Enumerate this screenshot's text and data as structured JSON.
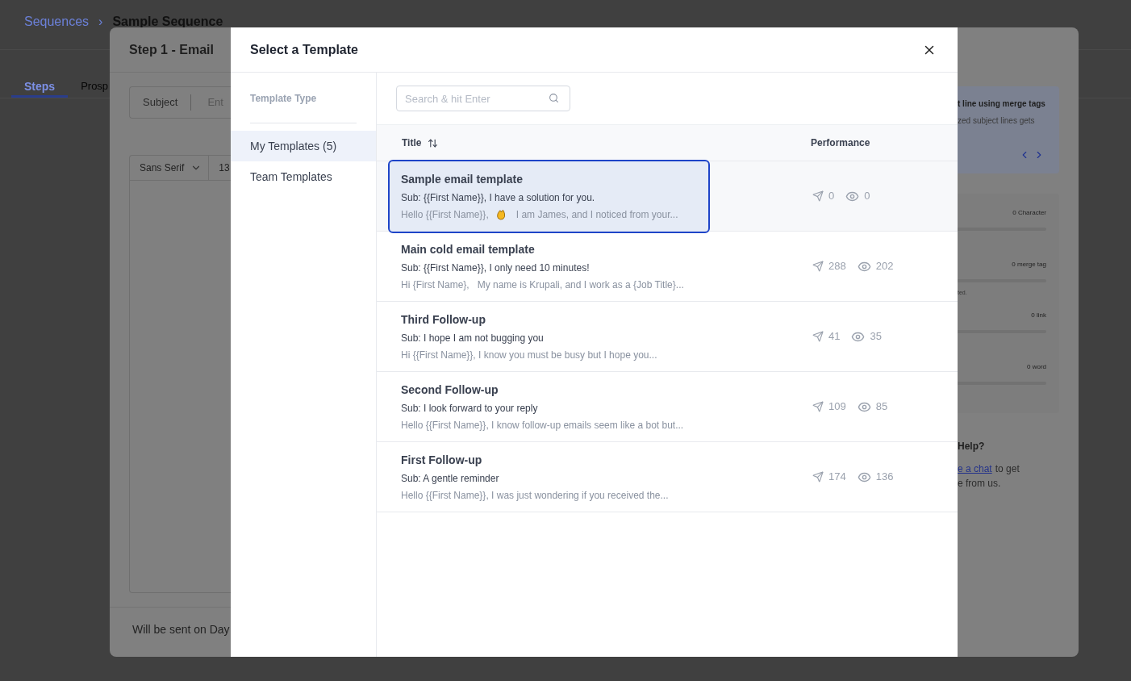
{
  "breadcrumb": {
    "parent": "Sequences",
    "separator": "›",
    "current": "Sample Sequence"
  },
  "page_tabs": [
    {
      "label": "Steps",
      "selected": true
    },
    {
      "label": "Prosp",
      "selected": false
    }
  ],
  "step_modal": {
    "title": "Step 1 - Email",
    "subject_label": "Subject",
    "subject_placeholder": "Ent",
    "font_family": "Sans Serif",
    "font_size": "13",
    "footer": "Will be sent on Day",
    "tip": {
      "title": "t line using merge tags",
      "text": "zed subject lines gets"
    },
    "stats": [
      {
        "label": "0 Character",
        "level": 0
      },
      {
        "label": "0 merge tag",
        "level": 0,
        "note": "ted."
      },
      {
        "label": "0 link",
        "level": 0
      },
      {
        "label": "0 word",
        "level": 0
      }
    ],
    "help": {
      "title": "Help?",
      "link": "e a chat",
      "text": "to get",
      "text2": "e from us."
    }
  },
  "template_modal": {
    "title": "Select a Template",
    "sidebar_heading": "Template Type",
    "types": [
      {
        "label": "My Templates (5)",
        "selected": true
      },
      {
        "label": "Team Templates",
        "selected": false
      }
    ],
    "search": {
      "placeholder": "Search & hit Enter"
    },
    "columns": [
      "Title",
      "Performance"
    ],
    "templates": [
      {
        "title": "Sample email template",
        "subject": "Sub: {{First Name}}, I have a solution for you.",
        "preview": "Hello {{First Name}},",
        "preview_after": "I am James, and I noticed from your...",
        "sent": "0",
        "opened": "0",
        "selected": true
      },
      {
        "title": "Main cold email template",
        "subject": "Sub: {{First Name}}, I only need 10 minutes!",
        "preview": "Hi {First Name},   My name is Krupali, and I work as a {Job Title}...",
        "sent": "288",
        "opened": "202",
        "selected": false
      },
      {
        "title": "Third Follow-up",
        "subject": "Sub: I hope I am not bugging you",
        "preview": "Hi {{First Name}}, I know you must be busy but I hope you...",
        "sent": "41",
        "opened": "35",
        "selected": false
      },
      {
        "title": "Second Follow-up",
        "subject": "Sub: I look forward to your reply",
        "preview": "Hello {{First Name}}, I know follow-up emails seem like a bot but...",
        "sent": "109",
        "opened": "85",
        "selected": false
      },
      {
        "title": "First Follow-up",
        "subject": "Sub: A gentle reminder",
        "preview": "Hello {{First Name}}, I was just wondering if you received the...",
        "sent": "174",
        "opened": "136",
        "selected": false
      }
    ]
  }
}
